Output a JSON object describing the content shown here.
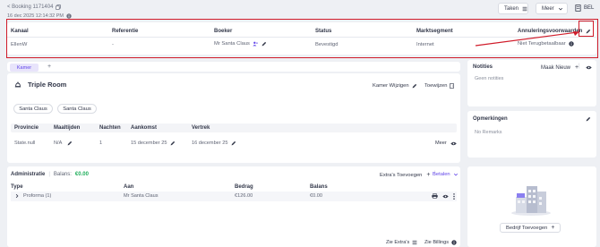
{
  "header": {
    "back_label": "< Booking 1171404",
    "created": "16 dec 2025 12:14:32 PM",
    "tasks_label": "Taken",
    "more_label": "Meer",
    "call_label": "BEL"
  },
  "booking": {
    "columns": [
      "Kanaal",
      "Referentie",
      "Boeker",
      "Status",
      "Marktsegment",
      "Annuleringsvoorwaarden"
    ],
    "values": {
      "channel": "EllenW",
      "reference": "-",
      "booker": "Mr Santa Claus",
      "status": "Bevestigd",
      "segment": "Internet",
      "cancellation": "Niet Terugbetaalbaar"
    }
  },
  "tabs": {
    "active": "Kamer",
    "add": "+"
  },
  "room": {
    "type": "Triple Room",
    "change_label": "Kamer Wijzigen",
    "assign_label": "Toewijzen",
    "guests": [
      "Santa Claus",
      "Santa Claus"
    ],
    "columns": [
      "Provincie",
      "Maaltijden",
      "Nachten",
      "Aankomst",
      "Vertrek"
    ],
    "row": {
      "province": "State.null",
      "meals": "N/A",
      "nights": "1",
      "arrival": "15 december 25",
      "departure": "16 december 25",
      "more": "Meer"
    }
  },
  "admin": {
    "title": "Administratie",
    "balance_label": "Balans:",
    "balance_value": "€0.00",
    "extras_label": "Extra's Toevoegen",
    "pay_label": "Betalen",
    "columns": [
      "Type",
      "Aan",
      "Bedrag",
      "Balans"
    ],
    "row": {
      "type": "Proforma (1)",
      "to": "Mr Santa Claus",
      "amount": "€126.00",
      "balance": "€0.00"
    },
    "footer_extras": "Zie Extra's",
    "footer_billings": "Zie Billings"
  },
  "notes": {
    "title": "Notities",
    "new_label": "Maak Nieuw",
    "empty": "Geen notities"
  },
  "remarks": {
    "title": "Opmerkingen",
    "empty": "No Remarks"
  },
  "company": {
    "add_label": "Bedrijf Toevoegen"
  },
  "colors": {
    "accent": "#6246ea",
    "highlight": "#d01c2a",
    "balance": "#1fae5b"
  }
}
